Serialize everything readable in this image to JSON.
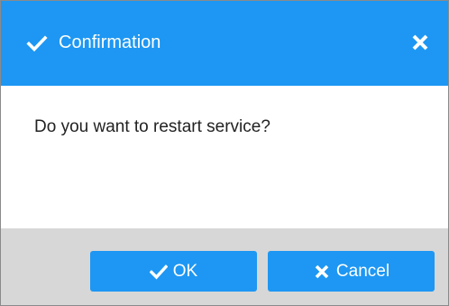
{
  "dialog": {
    "title": "Confirmation",
    "title_icon": "check-icon",
    "close_icon": "close-icon",
    "message": "Do you want to restart service?",
    "ok_label": "OK",
    "ok_icon": "check-icon",
    "cancel_label": "Cancel",
    "cancel_icon": "x-icon"
  },
  "colors": {
    "accent": "#1d97f3",
    "footer_bg": "#d7d7d7",
    "text": "#222222"
  }
}
